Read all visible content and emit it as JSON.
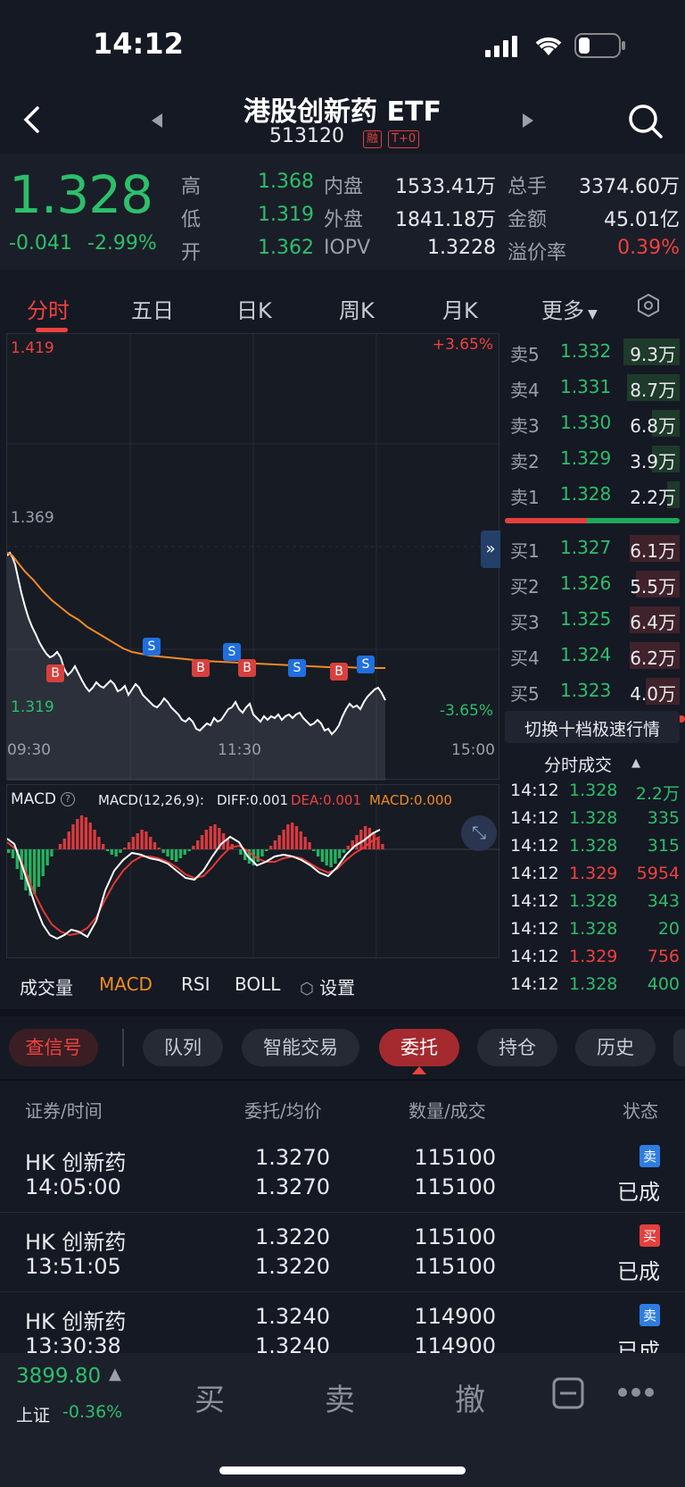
{
  "status": {
    "time": "14:12"
  },
  "header": {
    "title": "港股创新药 ETF",
    "code": "513120",
    "tag1": "融",
    "tag2": "T+0"
  },
  "quote": {
    "price": "1.328",
    "change": "-0.041",
    "change_pct": "-2.99%",
    "high_label": "高",
    "high": "1.368",
    "low_label": "低",
    "low": "1.319",
    "open_label": "开",
    "open": "1.362",
    "inner_label": "内盘",
    "inner": "1533.41万",
    "outer_label": "外盘",
    "outer": "1841.18万",
    "iopv_label": "IOPV",
    "iopv": "1.3228",
    "vol_label": "总手",
    "vol": "3374.60万",
    "amt_label": "金额",
    "amt": "45.01亿",
    "prem_label": "溢价率",
    "prem": "0.39%"
  },
  "tabs": [
    "分时",
    "五日",
    "日K",
    "周K",
    "月K",
    "更多"
  ],
  "chart": {
    "top_price": "1.419",
    "top_pct": "+3.65%",
    "mid_price": "1.369",
    "bottom_price": "1.319",
    "bottom_pct": "-3.65%",
    "x_start": "09:30",
    "x_mid": "11:30",
    "x_end": "15:00"
  },
  "macd": {
    "label": "MACD",
    "params": "MACD(12,26,9):",
    "diff": "DIFF:0.001",
    "dea": "DEA:0.001",
    "macd": "MACD:0.000"
  },
  "indicators": [
    "成交量",
    "MACD",
    "RSI",
    "BOLL",
    "设置"
  ],
  "asks": [
    {
      "label": "卖5",
      "price": "1.332",
      "vol": "9.3万",
      "depth": 0.9
    },
    {
      "label": "卖4",
      "price": "1.331",
      "vol": "8.7万",
      "depth": 0.85
    },
    {
      "label": "卖3",
      "price": "1.330",
      "vol": "6.8万",
      "depth": 0.45
    },
    {
      "label": "卖2",
      "price": "1.329",
      "vol": "3.9万",
      "depth": 0.45
    },
    {
      "label": "卖1",
      "price": "1.328",
      "vol": "2.2万",
      "depth": 0.2
    }
  ],
  "bids": [
    {
      "label": "买1",
      "price": "1.327",
      "vol": "6.1万",
      "depth": 0.8
    },
    {
      "label": "买2",
      "price": "1.326",
      "vol": "5.5万",
      "depth": 0.7
    },
    {
      "label": "买3",
      "price": "1.325",
      "vol": "6.4万",
      "depth": 0.8
    },
    {
      "label": "买4",
      "price": "1.324",
      "vol": "6.2万",
      "depth": 0.8
    },
    {
      "label": "买5",
      "price": "1.323",
      "vol": "4.0万",
      "depth": 0.55
    }
  ],
  "switch_label": "切换十档极速行情",
  "trades_title": "分时成交",
  "trades": [
    {
      "t": "14:12",
      "p": "1.328",
      "v": "2.2万",
      "side": "g"
    },
    {
      "t": "14:12",
      "p": "1.328",
      "v": "335",
      "side": "g"
    },
    {
      "t": "14:12",
      "p": "1.328",
      "v": "315",
      "side": "g"
    },
    {
      "t": "14:12",
      "p": "1.329",
      "v": "5954",
      "side": "r"
    },
    {
      "t": "14:12",
      "p": "1.328",
      "v": "343",
      "side": "g"
    },
    {
      "t": "14:12",
      "p": "1.328",
      "v": "20",
      "side": "g"
    },
    {
      "t": "14:12",
      "p": "1.329",
      "v": "756",
      "side": "r"
    },
    {
      "t": "14:12",
      "p": "1.328",
      "v": "400",
      "side": "g"
    }
  ],
  "pills": [
    "查信号",
    "队列",
    "智能交易",
    "委托",
    "持仓",
    "历史"
  ],
  "list_headers": [
    "证券/时间",
    "委托/均价",
    "数量/成交",
    "状态"
  ],
  "orders": [
    {
      "name": "HK 创新药",
      "time": "14:05:00",
      "price": "1.3270",
      "avg": "1.3270",
      "qty": "115100",
      "filled": "115100",
      "side": "卖",
      "status": "已成",
      "color": "#2f7de1"
    },
    {
      "name": "HK 创新药",
      "time": "13:51:05",
      "price": "1.3220",
      "avg": "1.3220",
      "qty": "115100",
      "filled": "115100",
      "side": "买",
      "status": "已成",
      "color": "#e5403d"
    },
    {
      "name": "HK 创新药",
      "time": "13:30:38",
      "price": "1.3240",
      "avg": "1.3240",
      "qty": "114900",
      "filled": "114900",
      "side": "卖",
      "status": "已成",
      "color": "#2f7de1"
    }
  ],
  "footer": {
    "index_value": "3899.80",
    "index_name": "上证",
    "index_change": "-0.36%",
    "buy": "买",
    "sell": "卖",
    "cancel": "撤"
  }
}
